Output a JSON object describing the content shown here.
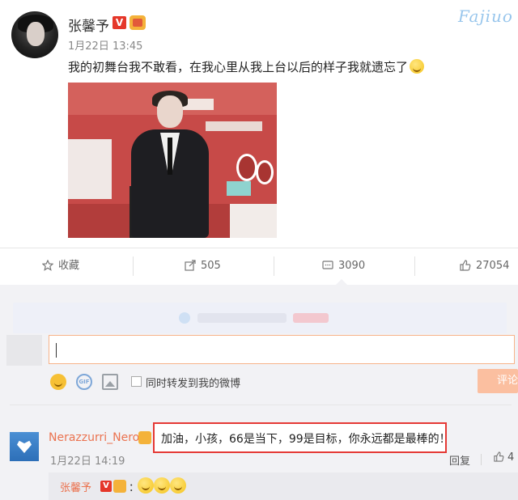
{
  "post": {
    "author": "张馨予",
    "verified_badge": "V",
    "time": "1月22日 13:45",
    "text": "我的初舞台我不敢看，在我心里从我上台以后的样子我就遗忘了",
    "watermark": "Fajiuo",
    "emoji": "smile-emoji"
  },
  "actions": {
    "favorite_label": "收藏",
    "repost_count": "505",
    "comment_count": "3090",
    "like_count": "27054"
  },
  "composer": {
    "repost_checkbox_label": "同时转发到我的微博",
    "submit_label": "评论"
  },
  "comment": {
    "user": "Nerazzurri_Nero",
    "text": "加油，小孩，66是当下，99是目标，你永远都是最棒的！",
    "time": "1月22日 14:19",
    "reply_label": "回复",
    "like_count": "4"
  },
  "reply": {
    "user": "张馨予",
    "verified_badge": "V",
    "colon": "：",
    "emoji_count": 3
  },
  "colors": {
    "username_orange": "#eb7350",
    "highlight_red": "#e53935",
    "verified_red": "#e5372a"
  }
}
